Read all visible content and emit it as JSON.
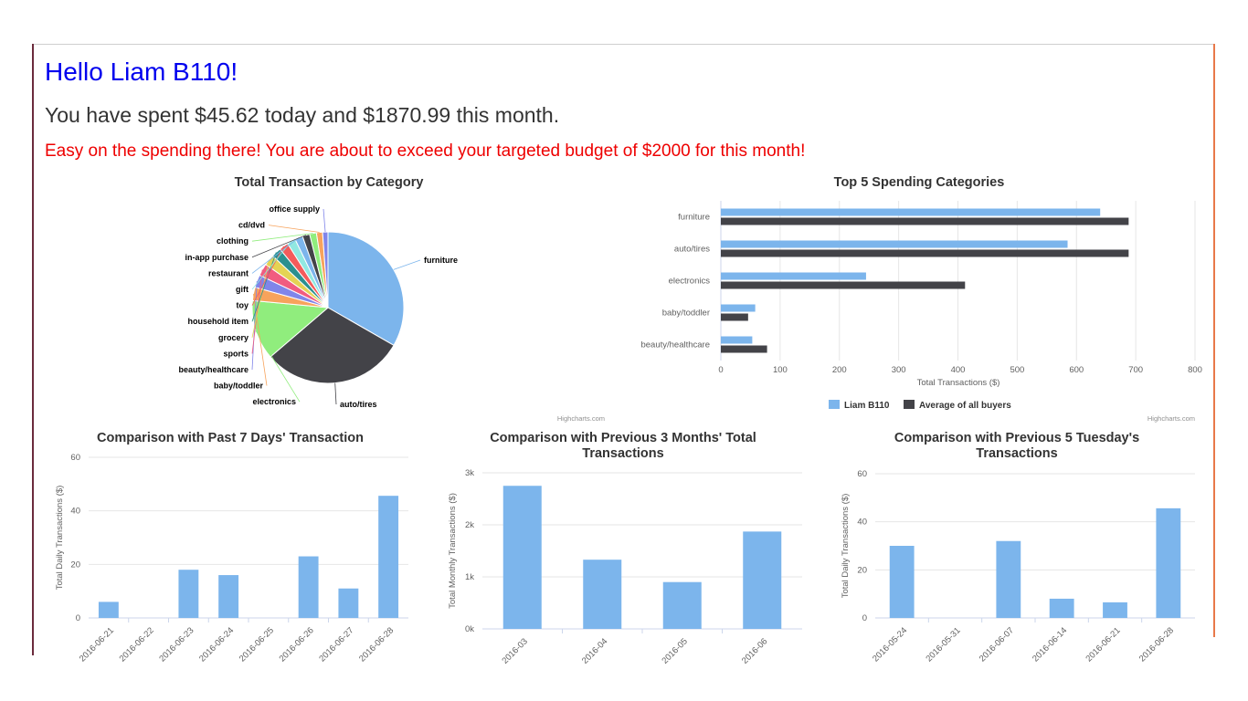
{
  "header": {
    "greeting": "Hello Liam B110!",
    "spent": "You have spent $45.62 today and $1870.99 this month.",
    "warning": "Easy on the spending there! You are about to exceed your targeted budget of $2000 for this month!"
  },
  "credits": "Highcharts.com",
  "colors": {
    "series_blue": "#7cb5ec",
    "series_dark": "#434348",
    "warning_red": "#ee0000",
    "greeting_blue": "#0000ee"
  },
  "chart_data": [
    {
      "type": "pie",
      "title": "Total Transaction by Category",
      "slices": [
        {
          "label": "furniture",
          "value": 640,
          "color": "#7cb5ec"
        },
        {
          "label": "auto/tires",
          "value": 585,
          "color": "#434348"
        },
        {
          "label": "electronics",
          "value": 245,
          "color": "#90ed7d"
        },
        {
          "label": "baby/toddler",
          "value": 55,
          "color": "#f7a35c"
        },
        {
          "label": "beauty/healthcare",
          "value": 52,
          "color": "#8085e9"
        },
        {
          "label": "sports",
          "value": 50,
          "color": "#f15c80"
        },
        {
          "label": "grocery",
          "value": 45,
          "color": "#e4d354"
        },
        {
          "label": "household item",
          "value": 40,
          "color": "#2b908f"
        },
        {
          "label": "toy",
          "value": 38,
          "color": "#f45b5b"
        },
        {
          "label": "gift",
          "value": 35,
          "color": "#91e8e1"
        },
        {
          "label": "restaurant",
          "value": 32,
          "color": "#7cb5ec"
        },
        {
          "label": "in-app purchase",
          "value": 30,
          "color": "#434348"
        },
        {
          "label": "clothing",
          "value": 28,
          "color": "#90ed7d"
        },
        {
          "label": "cd/dvd",
          "value": 25,
          "color": "#f7a35c"
        },
        {
          "label": "office supply",
          "value": 22,
          "color": "#8085e9"
        }
      ]
    },
    {
      "type": "bar",
      "title": "Top 5 Spending Categories",
      "categories": [
        "furniture",
        "auto/tires",
        "electronics",
        "baby/toddler",
        "beauty/healthcare"
      ],
      "series": [
        {
          "name": "Liam B110",
          "values": [
            640,
            585,
            245,
            58,
            53
          ],
          "color": "#7cb5ec"
        },
        {
          "name": "Average of all buyers",
          "values": [
            688,
            688,
            412,
            46,
            78
          ],
          "color": "#434348"
        }
      ],
      "xlabel": "Total Transactions ($)",
      "xlim": [
        0,
        800
      ],
      "ticks": [
        0,
        100,
        200,
        300,
        400,
        500,
        600,
        700,
        800
      ],
      "legend": "bottom-center"
    },
    {
      "type": "bar",
      "title": "Comparison with Past 7 Days' Transaction",
      "categories": [
        "2016-06-21",
        "2016-06-22",
        "2016-06-23",
        "2016-06-24",
        "2016-06-25",
        "2016-06-26",
        "2016-06-27",
        "2016-06-28"
      ],
      "values": [
        6,
        0,
        18,
        16,
        0,
        23,
        11,
        45.62
      ],
      "ylabel": "Total Daily Transactions ($)",
      "ylim": [
        0,
        60
      ],
      "ticks": [
        "0",
        "20",
        "40",
        "60"
      ]
    },
    {
      "type": "bar",
      "title": "Comparison with Previous 3 Months' Total Transactions",
      "categories": [
        "2016-03",
        "2016-04",
        "2016-05",
        "2016-06"
      ],
      "values": [
        2750,
        1330,
        900,
        1870.99
      ],
      "ylabel": "Total Monthly Transactions ($)",
      "ylim": [
        0,
        3000
      ],
      "ticks": [
        "0k",
        "1k",
        "2k",
        "3k"
      ]
    },
    {
      "type": "bar",
      "title": "Comparison with Previous 5 Tuesday's Transactions",
      "categories": [
        "2016-05-24",
        "2016-05-31",
        "2016-06-07",
        "2016-06-14",
        "2016-06-21",
        "2016-06-28"
      ],
      "values": [
        30,
        0,
        32,
        8,
        6.5,
        45.62
      ],
      "ylabel": "Total Daily Transactions ($)",
      "ylim": [
        0,
        60
      ],
      "ticks": [
        "0",
        "20",
        "40",
        "60"
      ]
    }
  ]
}
